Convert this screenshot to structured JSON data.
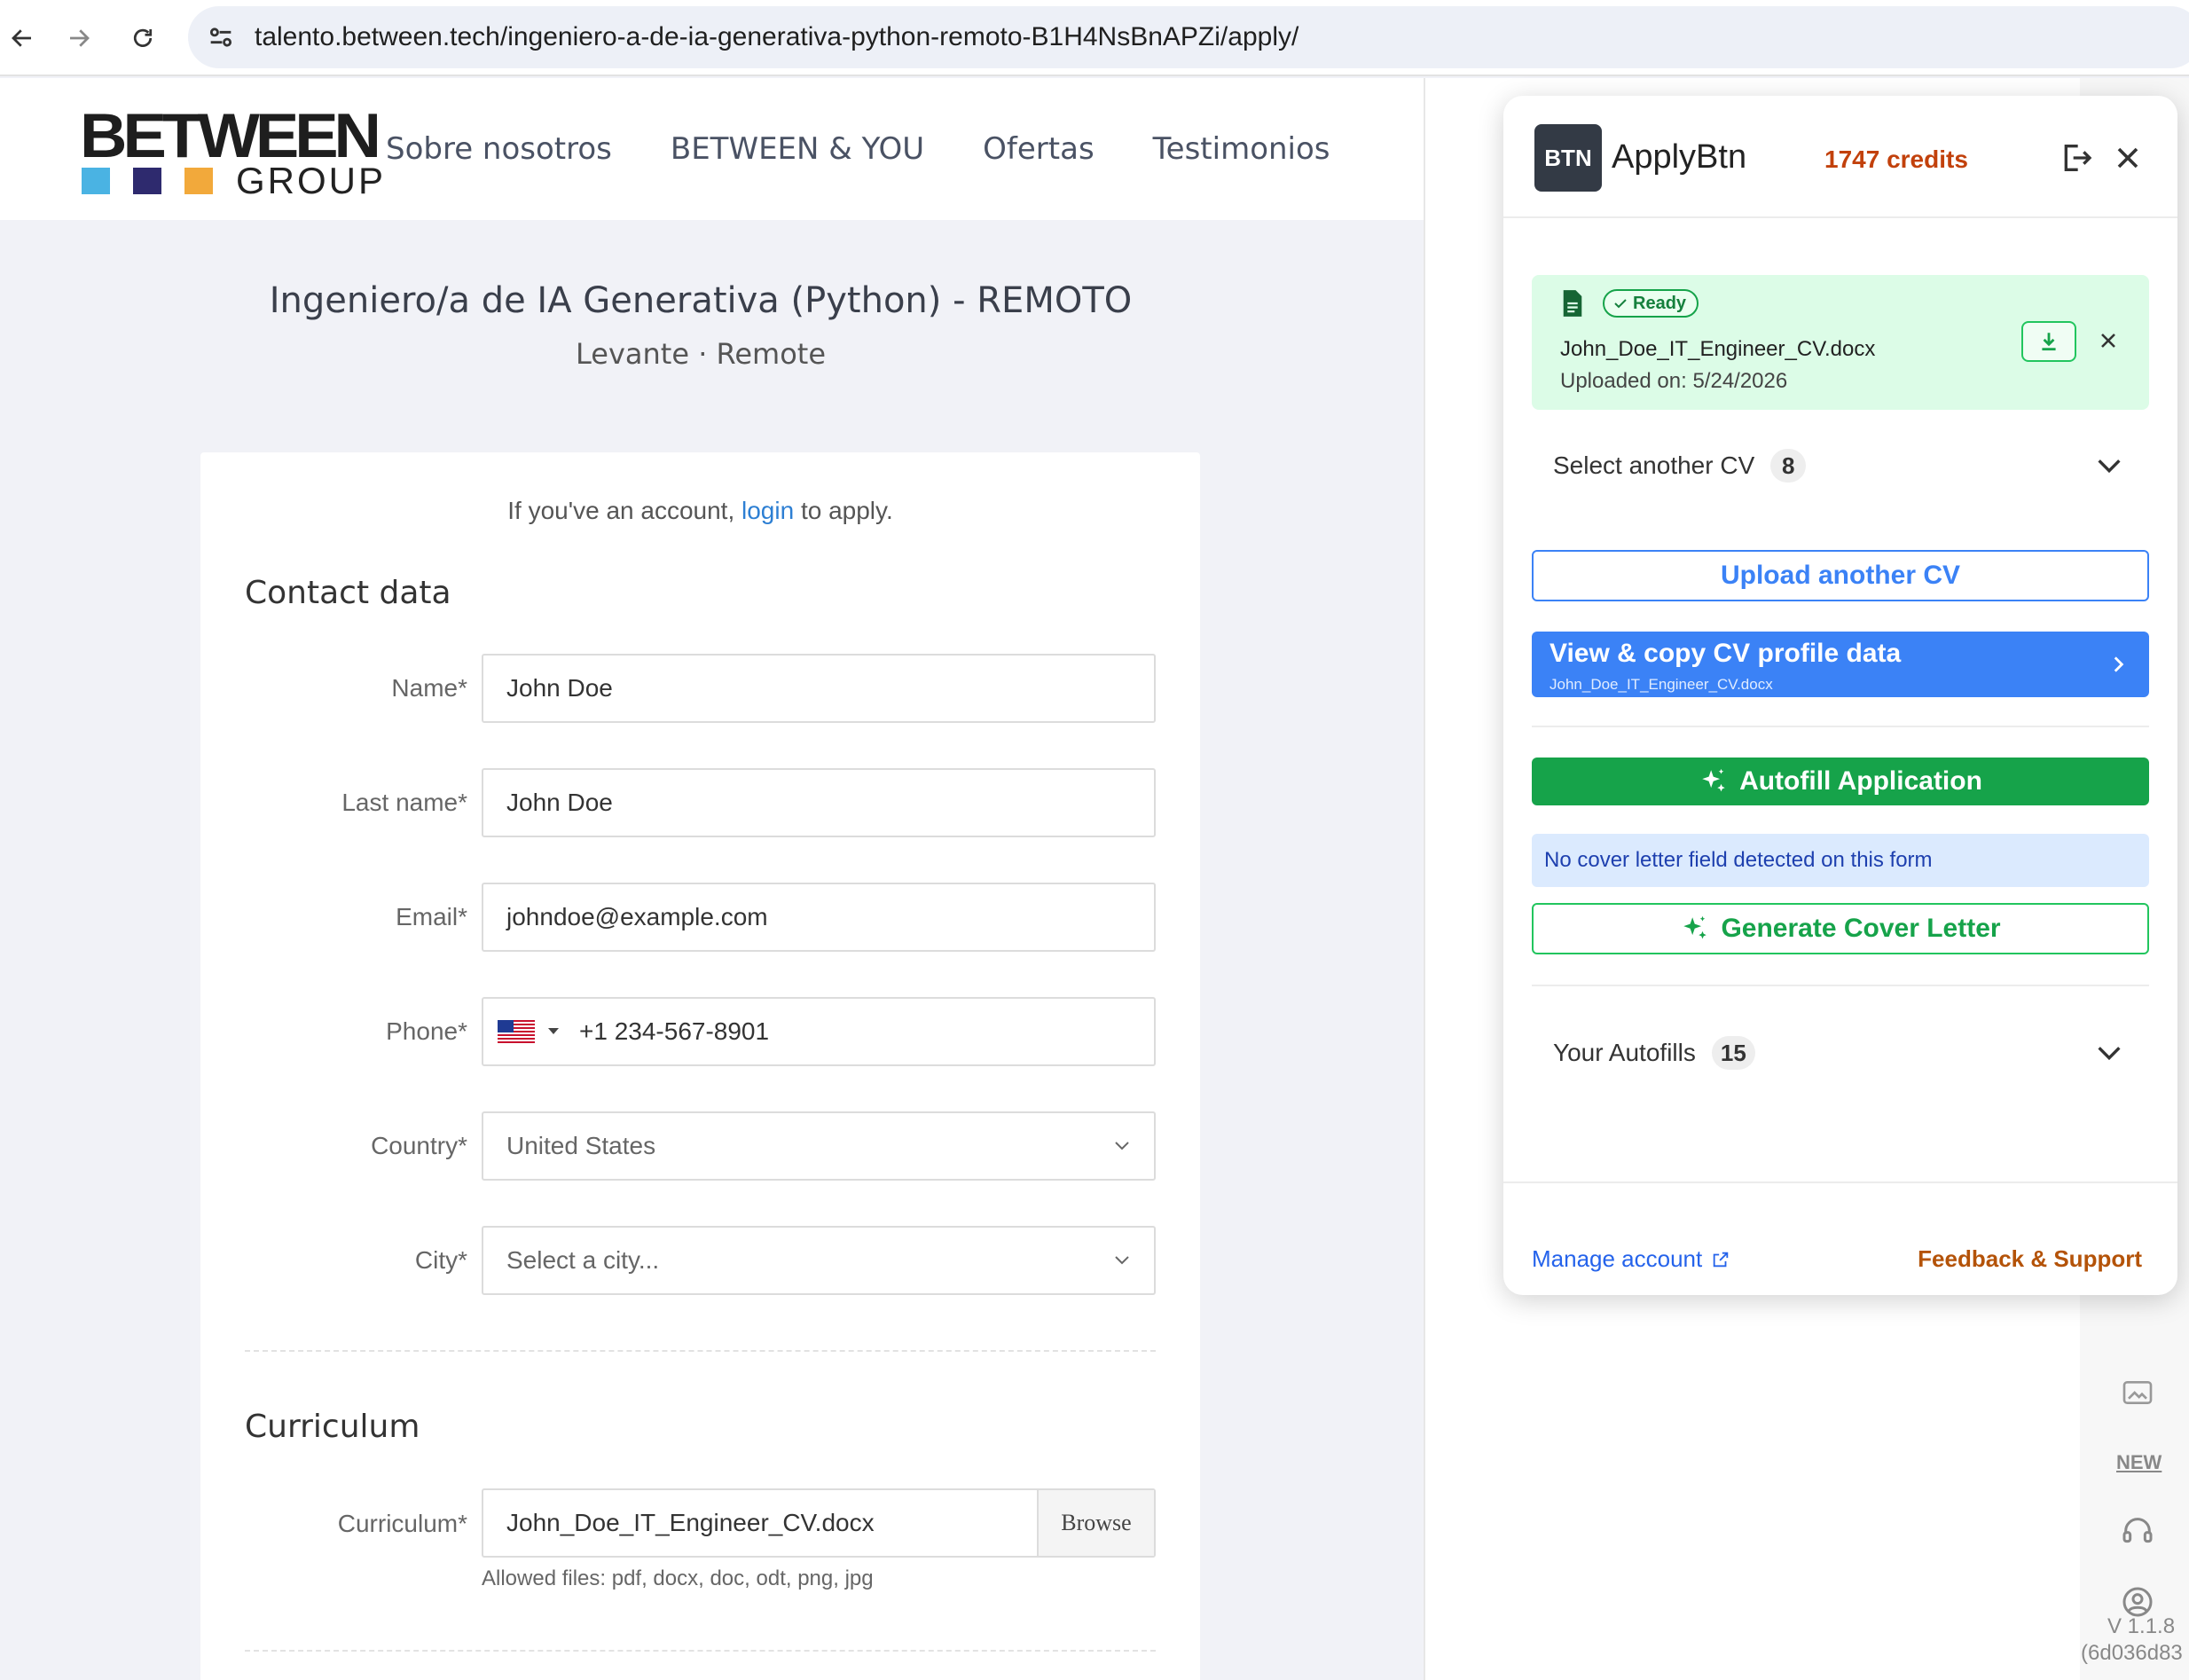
{
  "browser": {
    "url_host": "talento.between.tech",
    "url_path": "/ingeniero-a-de-ia-generativa-python-remoto-B1H4NsBnAPZi/apply/"
  },
  "site": {
    "logo_word": "BETWEEN",
    "logo_group": "GROUP",
    "logo_colors": [
      "#4ab3e3",
      "#2e2a6e",
      "#f2a93b"
    ],
    "nav": [
      "Sobre nosotros",
      "BETWEEN & YOU",
      "Ofertas",
      "Testimonios"
    ]
  },
  "job": {
    "title": "Ingeniero/a de IA Generativa (Python) - REMOTO",
    "subtitle": "Levante · Remote"
  },
  "form": {
    "login_prefix": "If you've an account, ",
    "login_link": "login",
    "login_suffix": " to apply.",
    "contact_title": "Contact data",
    "fields": {
      "name_label": "Name*",
      "name_value": "John Doe",
      "lastname_label": "Last name*",
      "lastname_value": "John Doe",
      "email_label": "Email*",
      "email_value": "johndoe@example.com",
      "phone_label": "Phone*",
      "phone_value": "+1 234-567-8901",
      "country_label": "Country*",
      "country_value": "United States",
      "city_label": "City*",
      "city_placeholder": "Select a city..."
    },
    "curriculum_title": "Curriculum",
    "curriculum_label": "Curriculum*",
    "curriculum_value": "John_Doe_IT_Engineer_CV.docx",
    "browse_label": "Browse",
    "allowed_files": "Allowed files: pdf, docx, doc, odt, png, jpg"
  },
  "extension": {
    "logo_text": "BTN",
    "brand": "ApplyBtn",
    "credits": "1747 credits",
    "cv_status": "Ready",
    "cv_file": "John_Doe_IT_Engineer_CV.docx",
    "cv_uploaded": "Uploaded on: 5/24/2026",
    "select_cv_label": "Select another CV",
    "select_cv_count": "8",
    "upload_label": "Upload another CV",
    "view_copy_label": "View & copy CV profile data",
    "view_copy_sub": "John_Doe_IT_Engineer_CV.docx",
    "autofill_label": "Autofill Application",
    "no_cover_info": "No cover letter field detected on this form",
    "generate_cover_label": "Generate Cover Letter",
    "autofills_label": "Your Autofills",
    "autofills_count": "15",
    "manage_account": "Manage account",
    "feedback": "Feedback & Support",
    "colors": {
      "blue": "#3b82f6",
      "green": "#16a34a",
      "credits": "#c2410c"
    }
  },
  "sidebar_rail": {
    "new_badge": "NEW",
    "version": "V 1.1.8",
    "build": "(6d036d83"
  }
}
